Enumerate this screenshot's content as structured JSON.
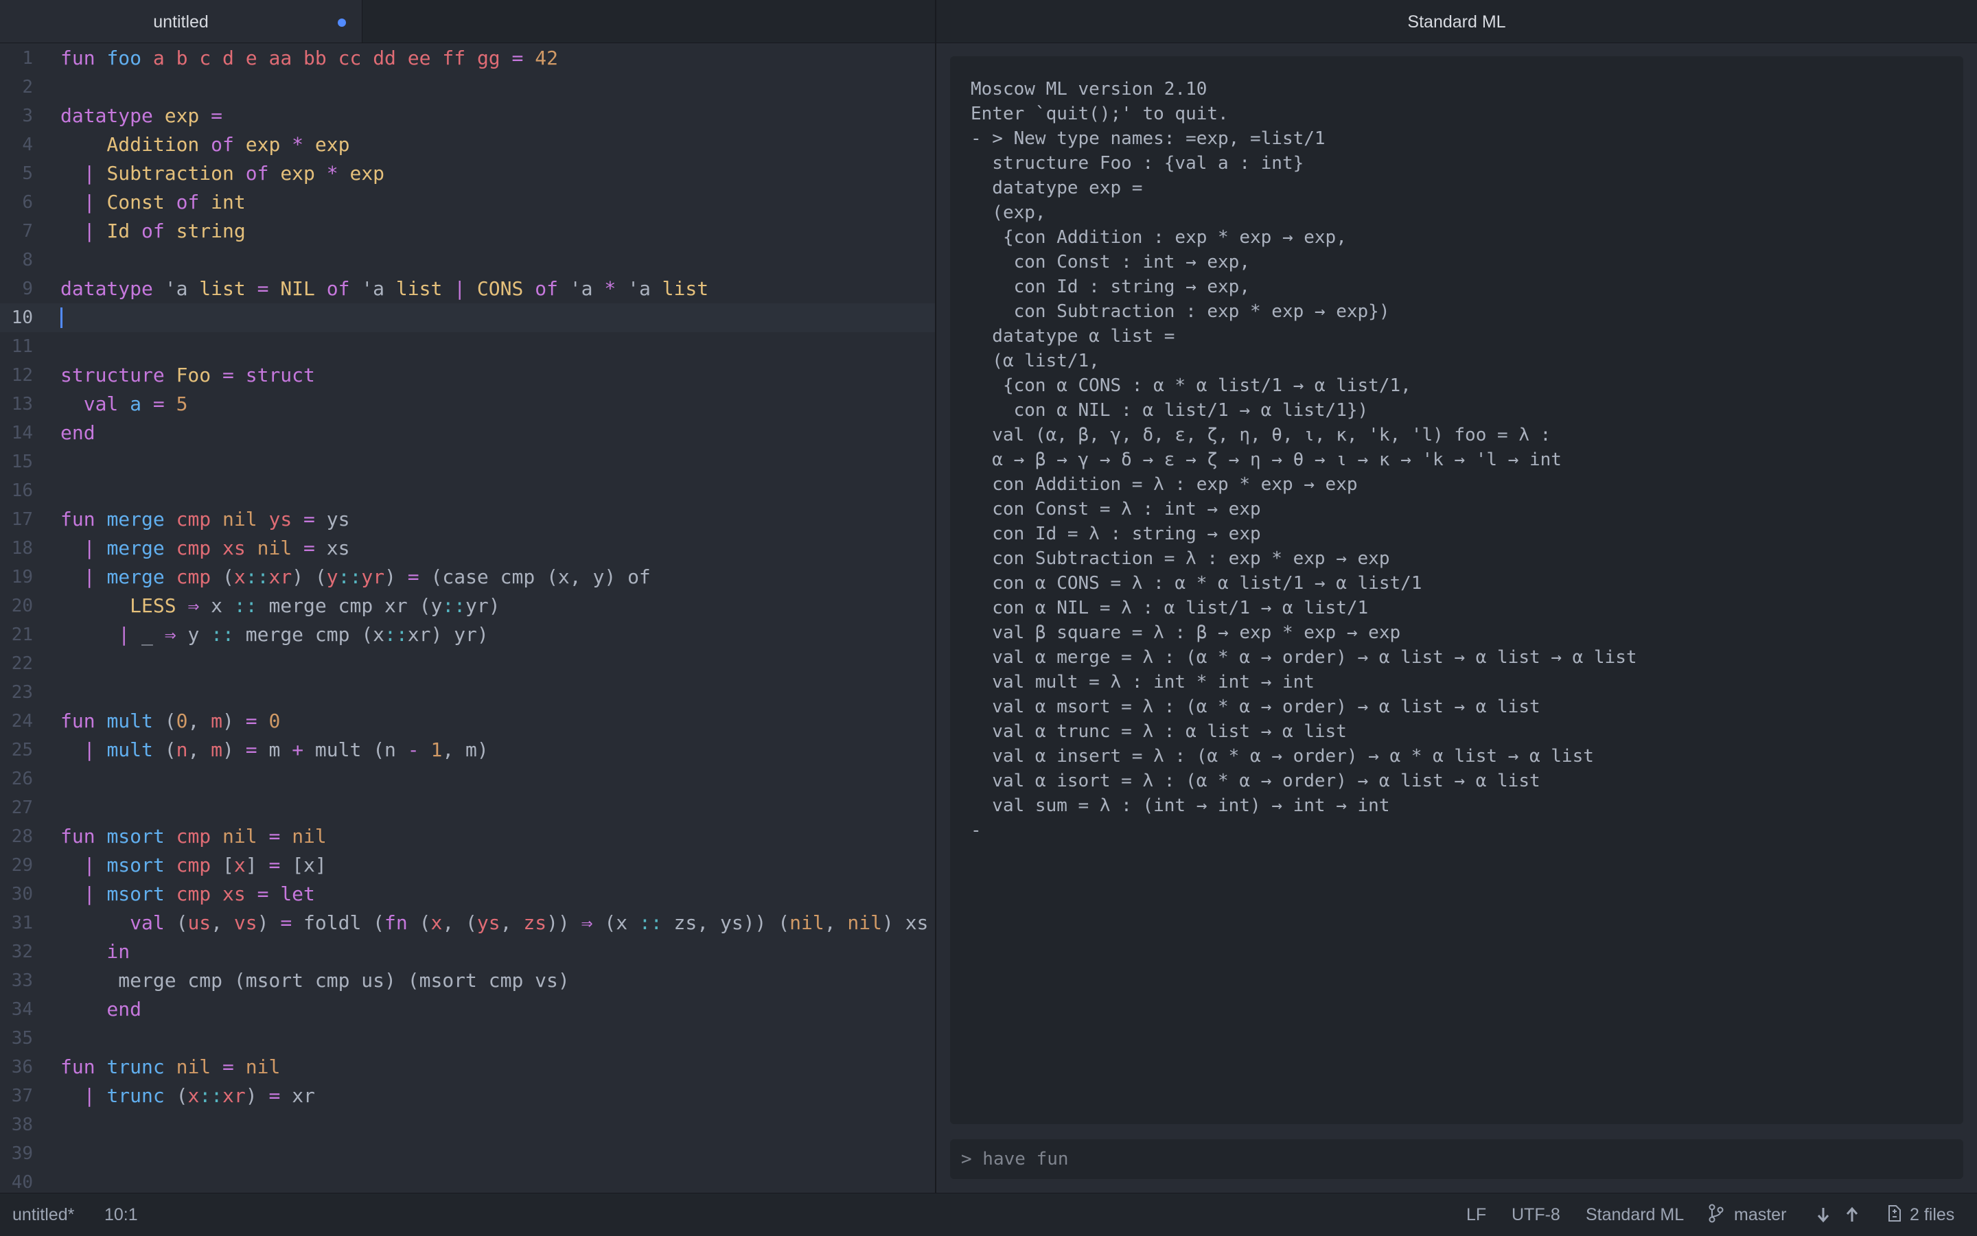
{
  "editor": {
    "tab": {
      "title": "untitled"
    },
    "current_line": 10,
    "lines": [
      [
        [
          "fun ",
          "keyword"
        ],
        [
          "foo ",
          "function"
        ],
        [
          "a ",
          "variable"
        ],
        [
          "b ",
          "variable"
        ],
        [
          "c ",
          "variable"
        ],
        [
          "d ",
          "variable"
        ],
        [
          "e ",
          "variable"
        ],
        [
          "aa ",
          "variable"
        ],
        [
          "bb ",
          "variable"
        ],
        [
          "cc ",
          "variable"
        ],
        [
          "dd ",
          "variable"
        ],
        [
          "ee ",
          "variable"
        ],
        [
          "ff ",
          "variable"
        ],
        [
          "gg ",
          "variable"
        ],
        [
          "= ",
          "operator"
        ],
        [
          "42",
          "number"
        ]
      ],
      [],
      [
        [
          "datatype ",
          "keyword"
        ],
        [
          "exp ",
          "type"
        ],
        [
          "=",
          "operator"
        ]
      ],
      [
        [
          "    Addition ",
          "type"
        ],
        [
          "of ",
          "keyword"
        ],
        [
          "exp ",
          "type"
        ],
        [
          "* ",
          "operator"
        ],
        [
          "exp",
          "type"
        ]
      ],
      [
        [
          "  | ",
          "operator"
        ],
        [
          "Subtraction ",
          "type"
        ],
        [
          "of ",
          "keyword"
        ],
        [
          "exp ",
          "type"
        ],
        [
          "* ",
          "operator"
        ],
        [
          "exp",
          "type"
        ]
      ],
      [
        [
          "  | ",
          "operator"
        ],
        [
          "Const ",
          "type"
        ],
        [
          "of ",
          "keyword"
        ],
        [
          "int",
          "type"
        ]
      ],
      [
        [
          "  | ",
          "operator"
        ],
        [
          "Id ",
          "type"
        ],
        [
          "of ",
          "keyword"
        ],
        [
          "string",
          "type"
        ]
      ],
      [],
      [
        [
          "datatype ",
          "keyword"
        ],
        [
          "'a ",
          "plain"
        ],
        [
          "list ",
          "type"
        ],
        [
          "= ",
          "operator"
        ],
        [
          "NIL ",
          "type"
        ],
        [
          "of ",
          "keyword"
        ],
        [
          "'a ",
          "plain"
        ],
        [
          "list ",
          "type"
        ],
        [
          "| ",
          "operator"
        ],
        [
          "CONS ",
          "type"
        ],
        [
          "of ",
          "keyword"
        ],
        [
          "'a ",
          "plain"
        ],
        [
          "* ",
          "operator"
        ],
        [
          "'a ",
          "plain"
        ],
        [
          "list",
          "type"
        ]
      ],
      [],
      [],
      [
        [
          "structure ",
          "keyword"
        ],
        [
          "Foo ",
          "type"
        ],
        [
          "= ",
          "operator"
        ],
        [
          "struct",
          "keyword"
        ]
      ],
      [
        [
          "  val ",
          "keyword"
        ],
        [
          "a ",
          "function"
        ],
        [
          "= ",
          "operator"
        ],
        [
          "5",
          "number"
        ]
      ],
      [
        [
          "end",
          "keyword"
        ]
      ],
      [],
      [],
      [
        [
          "fun ",
          "keyword"
        ],
        [
          "merge ",
          "function"
        ],
        [
          "cmp ",
          "variable"
        ],
        [
          "nil ",
          "orange"
        ],
        [
          "ys ",
          "variable"
        ],
        [
          "= ",
          "operator"
        ],
        [
          "ys",
          "plain"
        ]
      ],
      [
        [
          "  | ",
          "operator"
        ],
        [
          "merge ",
          "function"
        ],
        [
          "cmp ",
          "variable"
        ],
        [
          "xs ",
          "variable"
        ],
        [
          "nil ",
          "orange"
        ],
        [
          "= ",
          "operator"
        ],
        [
          "xs",
          "plain"
        ]
      ],
      [
        [
          "  | ",
          "operator"
        ],
        [
          "merge ",
          "function"
        ],
        [
          "cmp ",
          "variable"
        ],
        [
          "(",
          "plain"
        ],
        [
          "x",
          "variable"
        ],
        [
          "::",
          "op2"
        ],
        [
          "xr",
          "variable"
        ],
        [
          ") (",
          "plain"
        ],
        [
          "y",
          "variable"
        ],
        [
          "::",
          "op2"
        ],
        [
          "yr",
          "variable"
        ],
        [
          ") ",
          "plain"
        ],
        [
          "= ",
          "operator"
        ],
        [
          "(case cmp (x, y) of",
          "plain"
        ]
      ],
      [
        [
          "      LESS ",
          "type"
        ],
        [
          "⇒ ",
          "operator"
        ],
        [
          "x ",
          "plain"
        ],
        [
          ":: ",
          "op2"
        ],
        [
          "merge cmp xr (y",
          "plain"
        ],
        [
          "::",
          "op2"
        ],
        [
          "yr)",
          "plain"
        ]
      ],
      [
        [
          "     | ",
          "operator"
        ],
        [
          "_ ",
          "plain"
        ],
        [
          "⇒ ",
          "operator"
        ],
        [
          "y ",
          "plain"
        ],
        [
          ":: ",
          "op2"
        ],
        [
          "merge cmp (x",
          "plain"
        ],
        [
          "::",
          "op2"
        ],
        [
          "xr) yr)",
          "plain"
        ]
      ],
      [],
      [],
      [
        [
          "fun ",
          "keyword"
        ],
        [
          "mult ",
          "function"
        ],
        [
          "(",
          "plain"
        ],
        [
          "0",
          "number"
        ],
        [
          ", ",
          "plain"
        ],
        [
          "m",
          "variable"
        ],
        [
          ") ",
          "plain"
        ],
        [
          "= ",
          "operator"
        ],
        [
          "0",
          "number"
        ]
      ],
      [
        [
          "  | ",
          "operator"
        ],
        [
          "mult ",
          "function"
        ],
        [
          "(",
          "plain"
        ],
        [
          "n",
          "variable"
        ],
        [
          ", ",
          "plain"
        ],
        [
          "m",
          "variable"
        ],
        [
          ") ",
          "plain"
        ],
        [
          "= ",
          "operator"
        ],
        [
          "m ",
          "plain"
        ],
        [
          "+ ",
          "operator"
        ],
        [
          "mult (n ",
          "plain"
        ],
        [
          "- ",
          "operator"
        ],
        [
          "1",
          "number"
        ],
        [
          ", m)",
          "plain"
        ]
      ],
      [],
      [],
      [
        [
          "fun ",
          "keyword"
        ],
        [
          "msort ",
          "function"
        ],
        [
          "cmp ",
          "variable"
        ],
        [
          "nil ",
          "orange"
        ],
        [
          "= ",
          "operator"
        ],
        [
          "nil",
          "orange"
        ]
      ],
      [
        [
          "  | ",
          "operator"
        ],
        [
          "msort ",
          "function"
        ],
        [
          "cmp ",
          "variable"
        ],
        [
          "[",
          "plain"
        ],
        [
          "x",
          "variable"
        ],
        [
          "] ",
          "plain"
        ],
        [
          "= ",
          "operator"
        ],
        [
          "[x]",
          "plain"
        ]
      ],
      [
        [
          "  | ",
          "operator"
        ],
        [
          "msort ",
          "function"
        ],
        [
          "cmp ",
          "variable"
        ],
        [
          "xs ",
          "variable"
        ],
        [
          "= ",
          "operator"
        ],
        [
          "let",
          "keyword"
        ]
      ],
      [
        [
          "      val ",
          "keyword"
        ],
        [
          "(",
          "plain"
        ],
        [
          "us",
          "variable"
        ],
        [
          ", ",
          "plain"
        ],
        [
          "vs",
          "variable"
        ],
        [
          ") ",
          "plain"
        ],
        [
          "= ",
          "operator"
        ],
        [
          "foldl (",
          "plain"
        ],
        [
          "fn ",
          "keyword"
        ],
        [
          "(",
          "plain"
        ],
        [
          "x",
          "variable"
        ],
        [
          ", (",
          "plain"
        ],
        [
          "ys",
          "variable"
        ],
        [
          ", ",
          "plain"
        ],
        [
          "zs",
          "variable"
        ],
        [
          ")) ",
          "plain"
        ],
        [
          "⇒ ",
          "operator"
        ],
        [
          "(x ",
          "plain"
        ],
        [
          ":: ",
          "op2"
        ],
        [
          "zs, ys)) (",
          "plain"
        ],
        [
          "nil",
          "orange"
        ],
        [
          ", ",
          "plain"
        ],
        [
          "nil",
          "orange"
        ],
        [
          ") xs",
          "plain"
        ]
      ],
      [
        [
          "    in",
          "keyword"
        ]
      ],
      [
        [
          "     merge cmp (msort cmp us) (msort cmp vs)",
          "plain"
        ]
      ],
      [
        [
          "    end",
          "keyword"
        ]
      ],
      [],
      [
        [
          "fun ",
          "keyword"
        ],
        [
          "trunc ",
          "function"
        ],
        [
          "nil ",
          "orange"
        ],
        [
          "= ",
          "operator"
        ],
        [
          "nil",
          "orange"
        ]
      ],
      [
        [
          "  | ",
          "operator"
        ],
        [
          "trunc ",
          "function"
        ],
        [
          "(",
          "plain"
        ],
        [
          "x",
          "variable"
        ],
        [
          "::",
          "op2"
        ],
        [
          "xr",
          "variable"
        ],
        [
          ") ",
          "plain"
        ],
        [
          "= ",
          "operator"
        ],
        [
          "xr",
          "plain"
        ]
      ],
      [],
      [],
      []
    ]
  },
  "repl": {
    "title": "Standard ML",
    "output": [
      "Moscow ML version 2.10",
      "Enter `quit();' to quit.",
      "- > New type names: =exp, =list/1",
      "  structure Foo : {val a : int}",
      "  datatype exp =",
      "  (exp,",
      "   {con Addition : exp * exp → exp,",
      "    con Const : int → exp,",
      "    con Id : string → exp,",
      "    con Subtraction : exp * exp → exp})",
      "  datatype α list =",
      "  (α list/1,",
      "   {con α CONS : α * α list/1 → α list/1,",
      "    con α NIL : α list/1 → α list/1})",
      "  val (α, β, γ, δ, ε, ζ, η, θ, ι, κ, 'k, 'l) foo = λ :",
      "  α → β → γ → δ → ε → ζ → η → θ → ι → κ → 'k → 'l → int",
      "  con Addition = λ : exp * exp → exp",
      "  con Const = λ : int → exp",
      "  con Id = λ : string → exp",
      "  con Subtraction = λ : exp * exp → exp",
      "  con α CONS = λ : α * α list/1 → α list/1",
      "  con α NIL = λ : α list/1 → α list/1",
      "  val β square = λ : β → exp * exp → exp",
      "  val α merge = λ : (α * α → order) → α list → α list → α list",
      "  val mult = λ : int * int → int",
      "  val α msort = λ : (α * α → order) → α list → α list",
      "  val α trunc = λ : α list → α list",
      "  val α insert = λ : (α * α → order) → α * α list → α list",
      "  val α isort = λ : (α * α → order) → α list → α list",
      "  val sum = λ : (int → int) → int → int",
      "-"
    ],
    "input_placeholder": "> have fun"
  },
  "status": {
    "file": "untitled*",
    "cursor_position": "10:1",
    "line_ending": "LF",
    "encoding": "UTF-8",
    "grammar": "Standard ML",
    "branch": "master",
    "files": "2 files"
  }
}
